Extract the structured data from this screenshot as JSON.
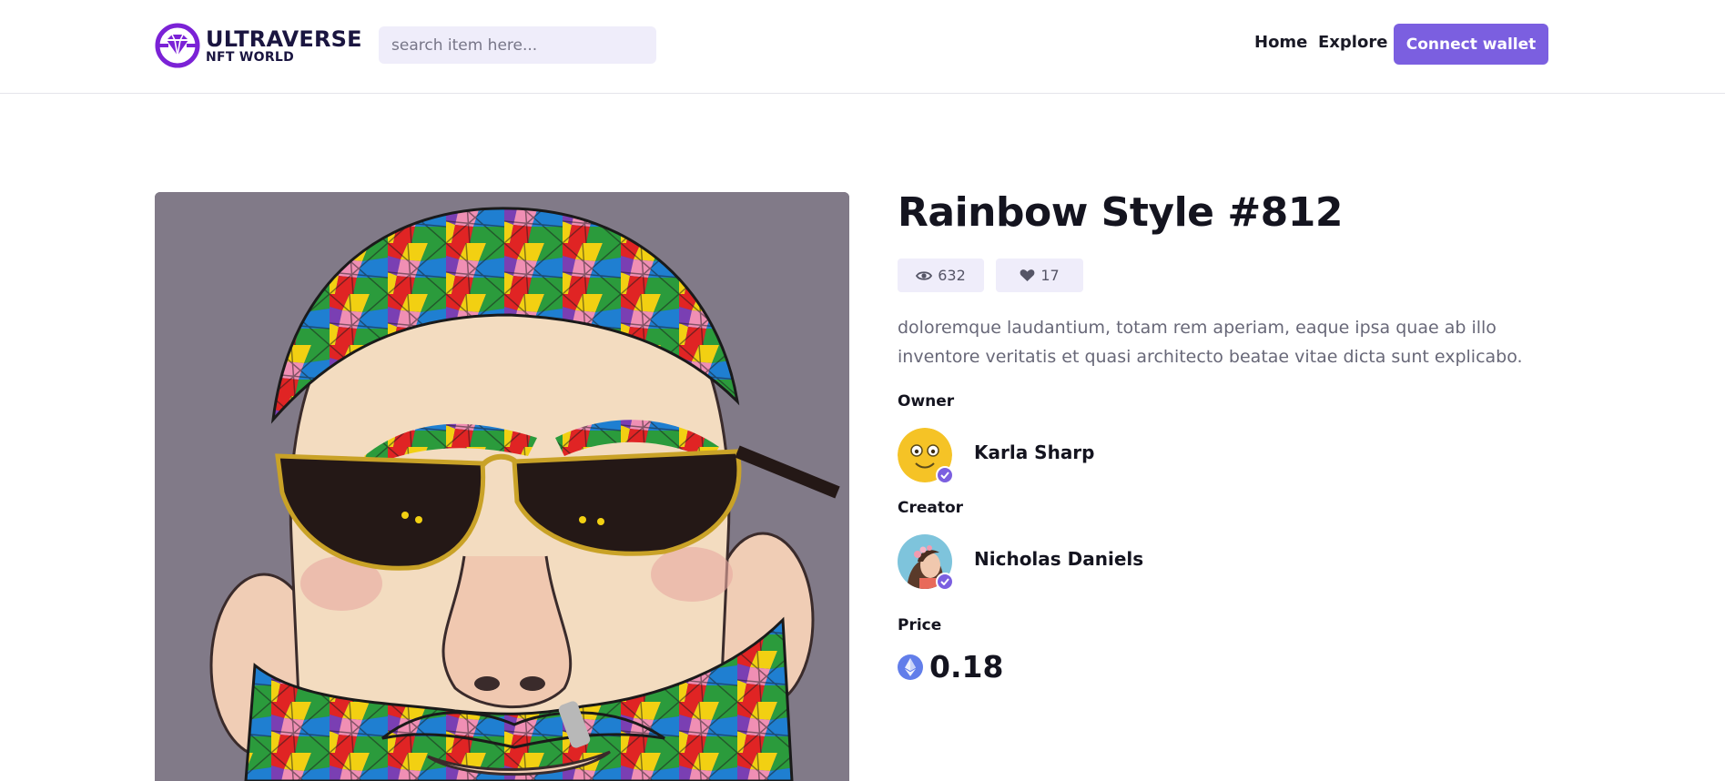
{
  "brand": {
    "name_line1": "ULTRAVERSE",
    "name_line2": "NFT WORLD",
    "accent_color": "#7b5fe0",
    "logo_icon": "diamond-logo-icon"
  },
  "search": {
    "placeholder": "search item here...",
    "value": ""
  },
  "nav": {
    "home_label": "Home",
    "explore_label": "Explore",
    "connect_label": "Connect wallet"
  },
  "item": {
    "title": "Rainbow Style #812",
    "views": "632",
    "likes": "17",
    "description": "doloremque laudantium, totam rem aperiam, eaque ipsa quae ab illo inventore veritatis et quasi architecto beatae vitae dicta sunt explicabo.",
    "artwork_icon": "painted-bearded-man-with-sunglasses-image"
  },
  "owner": {
    "label": "Owner",
    "name": "Karla Sharp",
    "verified": true
  },
  "creator": {
    "label": "Creator",
    "name": "Nicholas Daniels",
    "verified": true
  },
  "price": {
    "label": "Price",
    "value": "0.18",
    "currency_icon": "ethereum-icon"
  }
}
